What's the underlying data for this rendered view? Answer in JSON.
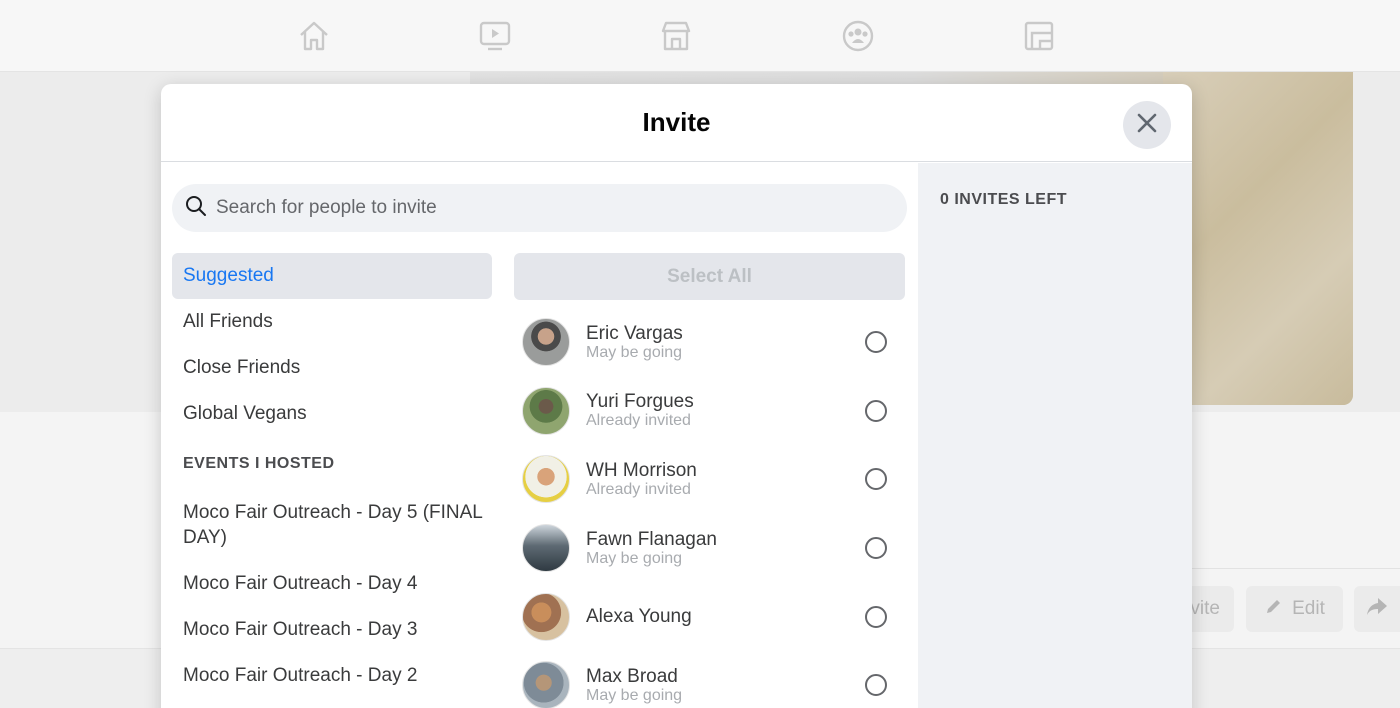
{
  "background": {
    "nav_icons": [
      "home-icon",
      "watch-icon",
      "marketplace-icon",
      "groups-icon",
      "gaming-icon"
    ],
    "buttons": [
      {
        "label": "Invite",
        "icon": "invite-icon"
      },
      {
        "label": "Edit",
        "icon": "pencil-icon"
      },
      {
        "label": "",
        "icon": "share-icon"
      }
    ]
  },
  "modal": {
    "title": "Invite",
    "close_icon": "close-icon",
    "search": {
      "placeholder": "Search for people to invite",
      "value": "",
      "icon": "search-icon"
    },
    "lists": [
      "Suggested",
      "All Friends",
      "Close Friends",
      "Global Vegans"
    ],
    "active_list": "Suggested",
    "events_header": "EVENTS I HOSTED",
    "events": [
      "Moco Fair Outreach - Day 5 (FINAL DAY)",
      "Moco Fair Outreach - Day 4",
      "Moco Fair Outreach - Day 3",
      "Moco Fair Outreach - Day 2"
    ],
    "select_all_label": "Select All",
    "friends": [
      {
        "name": "Eric Vargas",
        "status": "May be going",
        "avatar_color": "#8d8f8e"
      },
      {
        "name": "Yuri Forgues",
        "status": "Already invited",
        "avatar_color": "#7d8f6a"
      },
      {
        "name": "WH Morrison",
        "status": "Already invited",
        "avatar_color": "#e0c35a"
      },
      {
        "name": "Fawn Flanagan",
        "status": "May be going",
        "avatar_color": "#6f7b86"
      },
      {
        "name": "Alexa Young",
        "status": "",
        "avatar_color": "#b08a66"
      },
      {
        "name": "Max Broad",
        "status": "May be going",
        "avatar_color": "#8a97a3"
      }
    ],
    "invites_left": "0 INVITES LEFT"
  },
  "colors": {
    "accent": "#1877f2",
    "panel_bg": "#f0f2f5"
  }
}
